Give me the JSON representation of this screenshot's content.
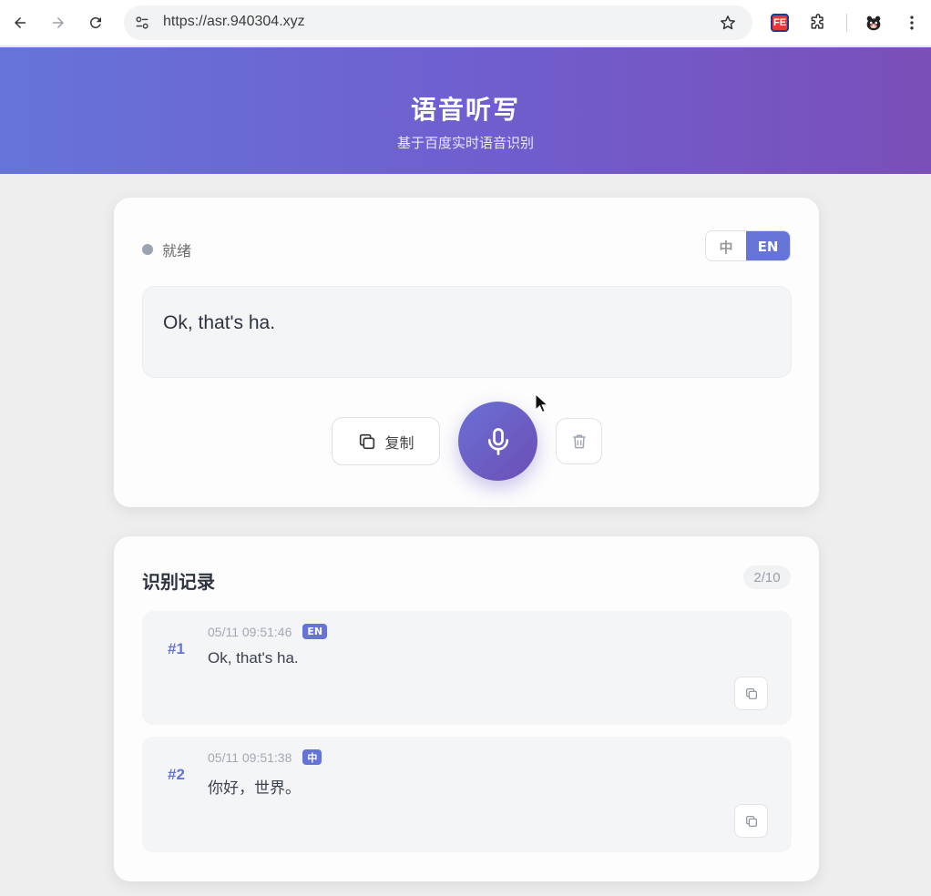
{
  "browser": {
    "url": "https://asr.940304.xyz",
    "extensions": [
      "fe-extension-icon",
      "puzzle-icon",
      "avatar-icon"
    ]
  },
  "header": {
    "title": "语音听写",
    "subtitle": "基于百度实时语音识别"
  },
  "recognizer": {
    "status": "就绪",
    "status_color": "#9aa4b2",
    "lang_options": [
      "中",
      "EN"
    ],
    "lang_selected": "EN",
    "transcript": "Ok, that's ha.",
    "copy_label": "复制"
  },
  "history": {
    "title": "识别记录",
    "count": "2/10",
    "items": [
      {
        "index": "#1",
        "time": "05/11 09:51:46",
        "lang": "EN",
        "text": "Ok, that's ha."
      },
      {
        "index": "#2",
        "time": "05/11 09:51:38",
        "lang": "中",
        "text": "你好，世界。"
      }
    ]
  },
  "colors": {
    "accent": "#6674d8",
    "header_start": "#6674d8",
    "header_end": "#7a4fb8"
  }
}
